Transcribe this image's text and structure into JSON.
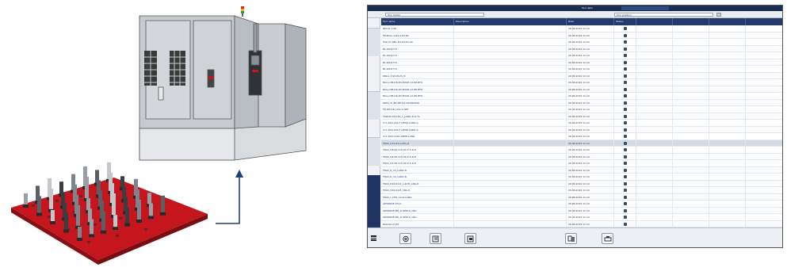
{
  "screen": {
    "title": "Tool data",
    "filter_left": "Tool holder",
    "filter_right": "Tool position",
    "columns": [
      "Tool name",
      "Description",
      "Date",
      "Status",
      "",
      "",
      ""
    ],
    "rows": [
      {
        "name": "BM-01 1-65",
        "date": "20.06.2019 11:10"
      },
      {
        "name": "FR-BALL-1-R4-A-RT-60",
        "date": "20.06.2019 11:10"
      },
      {
        "name": "HSK 63 RBL-D4-R3-E4-40",
        "date": "20.06.2019 11:10"
      },
      {
        "name": "BL-D8-R7-TL",
        "date": "20.06.2019 11:10"
      },
      {
        "name": "BL-D8-R7-TL",
        "date": "20.06.2019 11:10"
      },
      {
        "name": "BL-D8-R7-TL",
        "date": "20.06.2019 11:10"
      },
      {
        "name": "BL-D8-R7-TL",
        "date": "20.06.2019 11:10"
      },
      {
        "name": "DRILL_D10-PLUS_N",
        "date": "20.06.2019 11:10"
      },
      {
        "name": "BALL-HM-D6-R3-EDGE-12-RE-BFO",
        "date": "20.06.2019 11:10"
      },
      {
        "name": "BALL-HM-D6-R3-EDGE-12-RE-BFO",
        "date": "20.06.2019 11:10"
      },
      {
        "name": "BALL-HM-D6-R3-EDGE-12-RE-BFO",
        "date": "20.06.2019 11:10"
      },
      {
        "name": "DRILL-D_8D-RE-G4-CR-PRIMAR",
        "date": "20.06.2019 11:10"
      },
      {
        "name": "TD-RE-D8-L-R4-G-REF",
        "date": "20.06.2019 11:10"
      },
      {
        "name": "TORUS-D16-R2_L_LANG-R-G-TL",
        "date": "20.06.2019 11:10"
      },
      {
        "name": "CYL-D16-L50-F-GEDR-LANG-G",
        "date": "20.06.2019 11:10"
      },
      {
        "name": "CYL-D16-L50-F-GEDR-LANG-G",
        "date": "20.06.2019 11:10"
      },
      {
        "name": "CYL-D16-L100-GEDR-LANG",
        "date": "20.06.2019 11:10"
      },
      {
        "name": "FRAS_D12-R2-LANG_R",
        "date": "20.06.2019 11:10",
        "selected": true
      },
      {
        "name": "FRAS_D6-R2-H-T-D4-D.5-R-R",
        "date": "20.06.2019 11:10"
      },
      {
        "name": "FRAS_D4-R2-H-T-D4-D.5-R-R",
        "date": "20.06.2019 11:10"
      },
      {
        "name": "FRAS_D5-R2-H-T-D4-D.5-R-R",
        "date": "20.06.2019 11:10"
      },
      {
        "name": "FRAS_D_10_LANG-R",
        "date": "20.06.2019 11:10"
      },
      {
        "name": "FRAS_D_10_LANG-R",
        "date": "20.06.2019 11:10"
      },
      {
        "name": "FRAS_D20-R2-R_L-R-TR_LNG-R",
        "date": "20.06.2019 11:10"
      },
      {
        "name": "FRAS_D20-R2-R_LNG-R",
        "date": "20.06.2019 11:10"
      },
      {
        "name": "FRAS_L_D10_LG-R-LANG",
        "date": "20.06.2019 11:10"
      },
      {
        "name": "GEWINDE-D5_R",
        "date": "20.06.2019 11:10"
      },
      {
        "name": "GEWINDE-M8_R-GEW-R_LNG",
        "date": "20.06.2019 11:10"
      },
      {
        "name": "GEWINDE-M6_R-GEW-R_LNG",
        "date": "20.06.2019 11:10"
      },
      {
        "name": "Reamer-D-D6",
        "date": "20.06.2019 11:10"
      }
    ]
  },
  "colors": {
    "header_navy": "#233a6b",
    "titlebar": "#1a2d55",
    "arrow_blue": "#1f3f7a",
    "tray_red": "#c4161c"
  },
  "icons": [
    "menu-icon",
    "add-icon",
    "edit-icon",
    "copy-icon",
    "transfer-icon",
    "print-icon"
  ]
}
